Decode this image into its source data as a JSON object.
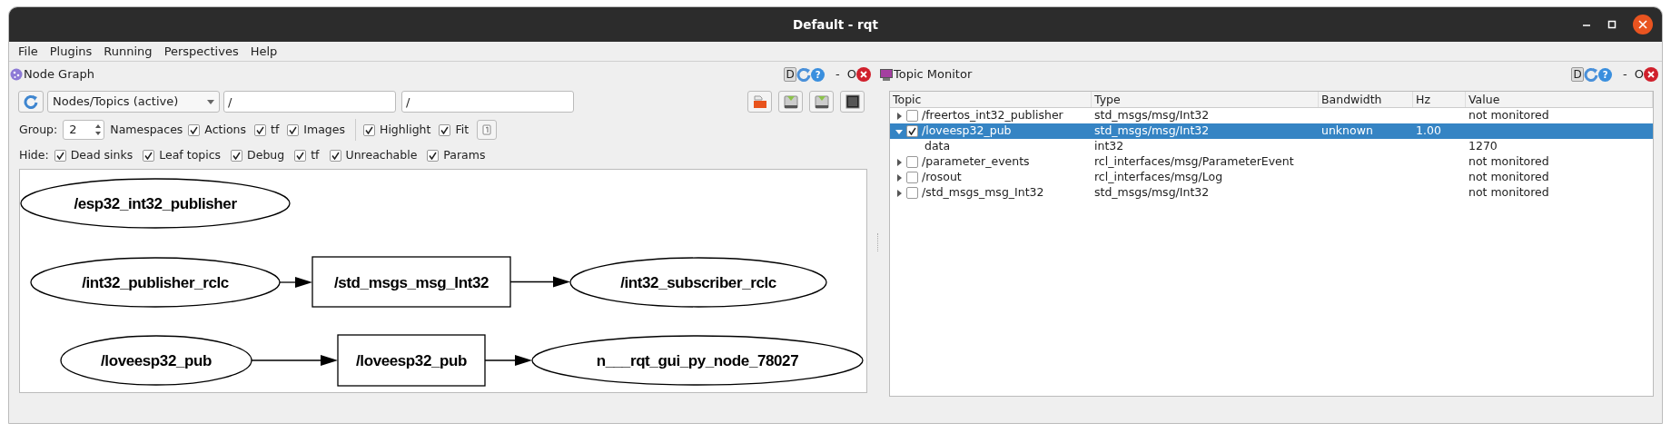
{
  "window": {
    "title": "Default - rqt"
  },
  "menu": [
    "File",
    "Plugins",
    "Running",
    "Perspectives",
    "Help"
  ],
  "node_graph": {
    "title": "Node Graph",
    "dock_buttons": {
      "d": "D",
      "help": "?",
      "minimize": "-",
      "float": "O"
    },
    "mode": "Nodes/Topics (active)",
    "node_filter": "/",
    "topic_filter": "/",
    "group_label": "Group:",
    "group_value": "2",
    "namespaces_label": "Namespaces",
    "options": [
      {
        "label": "Actions",
        "checked": true,
        "kind": "check"
      },
      {
        "label": "tf",
        "checked": true,
        "kind": "check"
      },
      {
        "label": "Images",
        "checked": true,
        "kind": "check"
      },
      {
        "kind": "separator"
      },
      {
        "label": "Highlight",
        "checked": true,
        "kind": "check"
      },
      {
        "label": "Fit",
        "checked": true,
        "kind": "check"
      }
    ],
    "hide_label": "Hide:",
    "hide": [
      {
        "label": "Dead sinks",
        "checked": true
      },
      {
        "label": "Leaf topics",
        "checked": true
      },
      {
        "label": "Debug",
        "checked": true
      },
      {
        "label": "tf",
        "checked": true
      },
      {
        "label": "Unreachable",
        "checked": true
      },
      {
        "label": "Params",
        "checked": true
      }
    ],
    "graph": [
      {
        "nodes": [
          {
            "label": "/esp32_int32_publisher",
            "kind": "node"
          }
        ]
      },
      {
        "nodes": [
          {
            "label": "/int32_publisher_rclc",
            "kind": "node"
          },
          {
            "label": "/std_msgs_msg_Int32",
            "kind": "topic"
          },
          {
            "label": "/int32_subscriber_rclc",
            "kind": "node"
          }
        ]
      },
      {
        "nodes": [
          {
            "label": "/loveesp32_pub",
            "kind": "node"
          },
          {
            "label": "/loveesp32_pub",
            "kind": "topic"
          },
          {
            "label": "n___rqt_gui_py_node_78027",
            "kind": "node"
          }
        ]
      }
    ]
  },
  "topic_monitor": {
    "title": "Topic Monitor",
    "dock_buttons": {
      "d": "D",
      "help": "?",
      "minimize": "-",
      "float": "O"
    },
    "columns": [
      "Topic",
      "Type",
      "Bandwidth",
      "Hz",
      "Value"
    ],
    "rows": [
      {
        "topic": "/freertos_int32_publisher",
        "type": "std_msgs/msg/Int32",
        "value": "not monitored",
        "checked": false,
        "expanded": false,
        "selected": false
      },
      {
        "topic": "/loveesp32_pub",
        "type": "std_msgs/msg/Int32",
        "bandwidth": "unknown",
        "hz": "1.00",
        "checked": true,
        "expanded": true,
        "selected": true,
        "children": [
          {
            "topic": "data",
            "type": "int32",
            "value": "1270"
          }
        ]
      },
      {
        "topic": "/parameter_events",
        "type": "rcl_interfaces/msg/ParameterEvent",
        "value": "not monitored",
        "checked": false,
        "expanded": false,
        "selected": false
      },
      {
        "topic": "/rosout",
        "type": "rcl_interfaces/msg/Log",
        "value": "not monitored",
        "checked": false,
        "expanded": false,
        "selected": false
      },
      {
        "topic": "/std_msgs_msg_Int32",
        "type": "std_msgs/msg/Int32",
        "value": "not monitored",
        "checked": false,
        "expanded": false,
        "selected": false
      }
    ]
  }
}
